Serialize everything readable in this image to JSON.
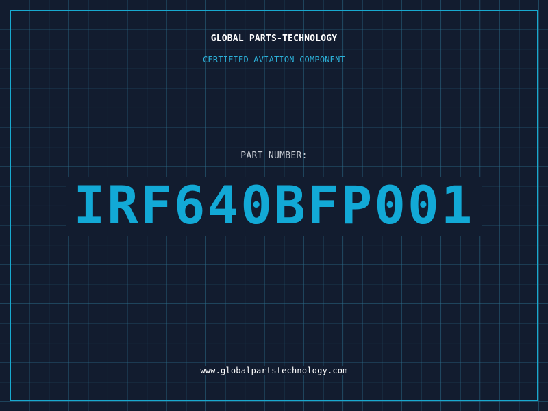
{
  "header": {
    "company": "GLOBAL PARTS-TECHNOLOGY",
    "tagline": "CERTIFIED AVIATION COMPONENT"
  },
  "part": {
    "label": "PART NUMBER:",
    "number": "IRF640BFP001"
  },
  "footer": {
    "website": "www.globalpartstechnology.com"
  },
  "colors": {
    "background": "#121c2f",
    "grid": "#2c6e8c",
    "frame": "#18a9cf",
    "accent": "#12a9d6",
    "text": "#ffffff",
    "muted_text": "#c9cdd4"
  }
}
